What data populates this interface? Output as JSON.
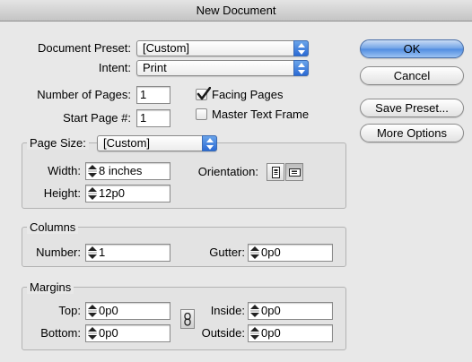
{
  "window": {
    "title": "New Document"
  },
  "document_preset": {
    "label": "Document Preset:",
    "value": "[Custom]"
  },
  "intent": {
    "label": "Intent:",
    "value": "Print"
  },
  "pages": {
    "number_label": "Number of Pages:",
    "number_value": "1",
    "start_label": "Start Page #:",
    "start_value": "1"
  },
  "checkboxes": {
    "facing_pages": {
      "label": "Facing Pages",
      "checked": true
    },
    "master_text_frame": {
      "label": "Master Text Frame",
      "checked": false
    }
  },
  "page_size": {
    "label": "Page Size:",
    "value": "[Custom]",
    "width_label": "Width:",
    "width_value": "8 inches",
    "height_label": "Height:",
    "height_value": "12p0",
    "orientation_label": "Orientation:",
    "orientation_selected": "landscape"
  },
  "columns": {
    "title": "Columns",
    "number_label": "Number:",
    "number_value": "1",
    "gutter_label": "Gutter:",
    "gutter_value": "0p0"
  },
  "margins": {
    "title": "Margins",
    "top_label": "Top:",
    "top_value": "0p0",
    "bottom_label": "Bottom:",
    "bottom_value": "0p0",
    "inside_label": "Inside:",
    "inside_value": "0p0",
    "outside_label": "Outside:",
    "outside_value": "0p0"
  },
  "buttons": {
    "ok": "OK",
    "cancel": "Cancel",
    "save_preset": "Save Preset...",
    "more_options": "More Options"
  },
  "icons": {
    "popup_arrow": "up-down-arrows-icon",
    "spinner": "stepper-arrows-icon",
    "portrait": "portrait-page-icon",
    "landscape": "landscape-page-icon",
    "chain": "chain-link-icon"
  },
  "colors": {
    "accent": "#4e8be0",
    "background": "#e8e8e8"
  }
}
